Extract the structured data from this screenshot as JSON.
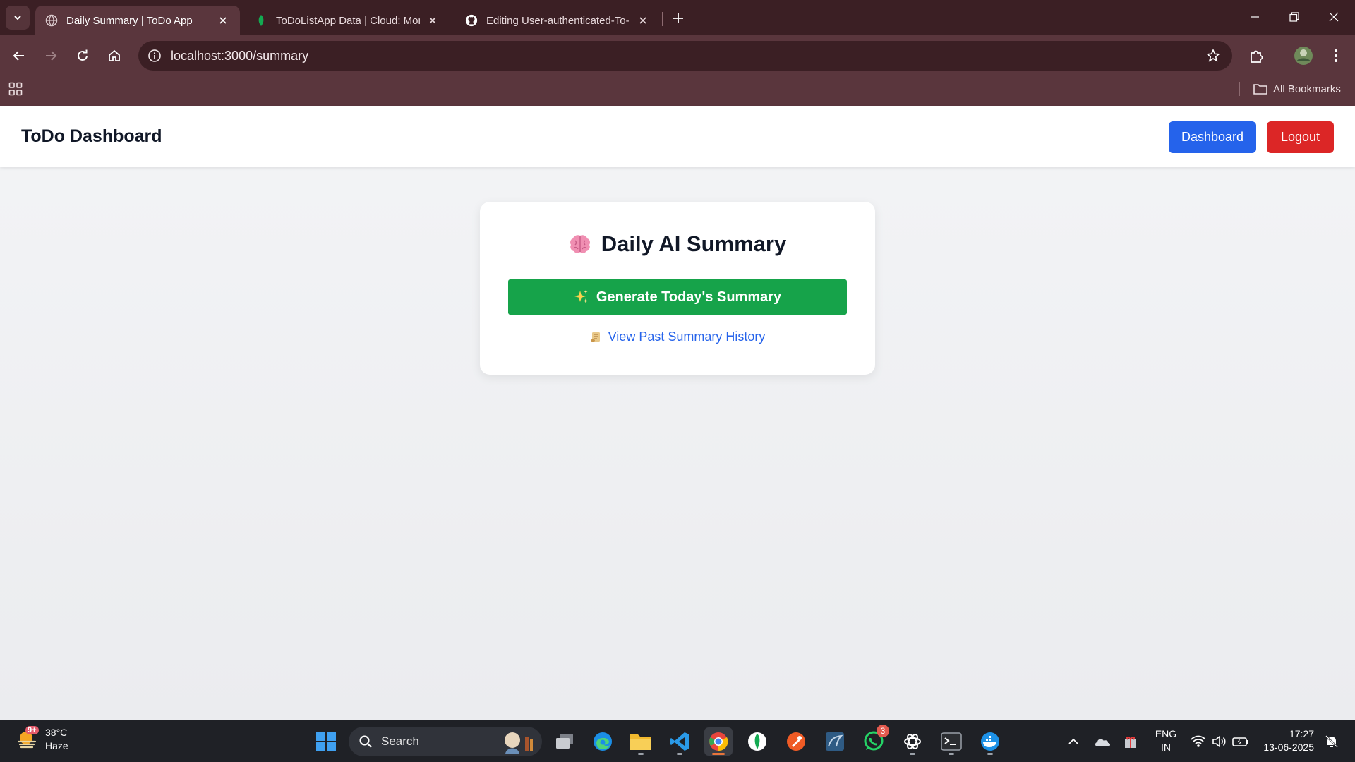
{
  "browser": {
    "tabs": [
      {
        "title": "Daily Summary | ToDo App",
        "favicon": "globe-icon",
        "active": true
      },
      {
        "title": "ToDoListApp Data | Cloud: Mon",
        "favicon": "mongodb-leaf-icon",
        "active": false
      },
      {
        "title": "Editing User-authenticated-To-I",
        "favicon": "github-icon",
        "active": false
      }
    ],
    "url": "localhost:3000/summary",
    "bookmarks_label": "All Bookmarks"
  },
  "app": {
    "brand": "ToDo Dashboard",
    "nav": {
      "dashboard_label": "Dashboard",
      "logout_label": "Logout"
    },
    "colors": {
      "dashboard_button": "#2563eb",
      "logout_button": "#dc2626",
      "generate_button": "#16a34a",
      "link": "#2563eb"
    }
  },
  "summary_card": {
    "title": "Daily AI Summary",
    "title_icon": "brain-icon",
    "generate_label": "Generate Today's Summary",
    "generate_icon": "sparkles-icon",
    "history_label": "View Past Summary History",
    "history_icon": "scroll-icon"
  },
  "taskbar": {
    "weather": {
      "temp": "38°C",
      "condition": "Haze",
      "badge": "9+"
    },
    "search_label": "Search",
    "whatsapp_badge": "3",
    "language": {
      "line1": "ENG",
      "line2": "IN"
    },
    "clock": {
      "time": "17:27",
      "date": "13-06-2025"
    }
  }
}
